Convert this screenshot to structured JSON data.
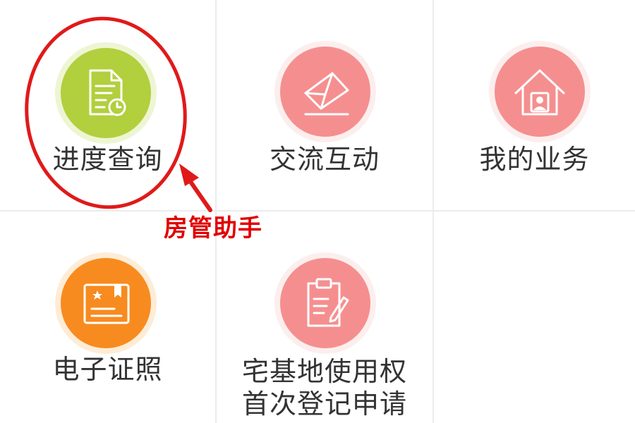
{
  "tiles": [
    {
      "label": "进度查询",
      "icon": "document-history-icon",
      "color": "#b2cf3e"
    },
    {
      "label": "交流互动",
      "icon": "envelope-icon",
      "color": "#f58f8f"
    },
    {
      "label": "我的业务",
      "icon": "house-user-icon",
      "color": "#f58f8f"
    },
    {
      "label": "电子证照",
      "icon": "certificate-icon",
      "color": "#f78b1f"
    },
    {
      "label_line1": "宅基地使用权",
      "label_line2": "首次登记申请",
      "icon": "clipboard-edit-icon",
      "color": "#f58f8f"
    }
  ],
  "annotation": {
    "text": "房管助手",
    "color": "#e00000"
  },
  "theme": {
    "grid_line": "#ececec",
    "label_color": "#333333",
    "icon_halo": "#fdeeee"
  }
}
